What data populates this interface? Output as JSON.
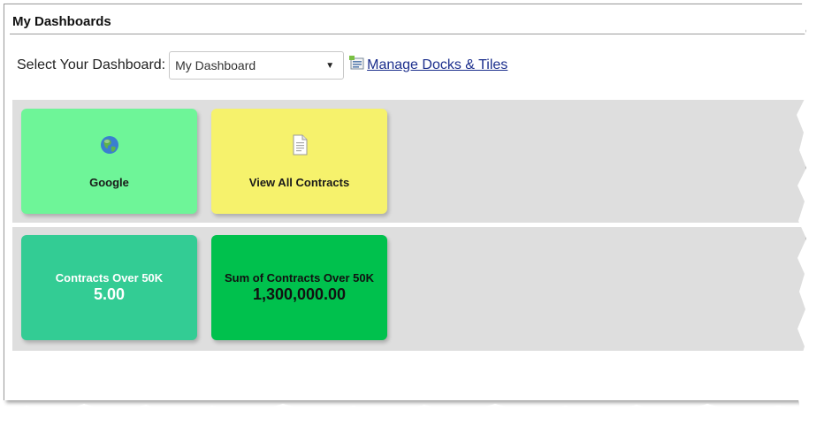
{
  "header": {
    "title": "My Dashboards"
  },
  "selector": {
    "label": "Select Your Dashboard:",
    "selected": "My Dashboard",
    "manage_link": "Manage Docks & Tiles"
  },
  "docks": [
    {
      "tiles": [
        {
          "label": "Google",
          "icon": "globe-icon",
          "color": "#6ef598"
        },
        {
          "label": "View All Contracts",
          "icon": "document-icon",
          "color": "#f6f26c"
        }
      ]
    },
    {
      "tiles": [
        {
          "label": "Contracts Over 50K",
          "value": "5.00",
          "color": "#33cc94"
        },
        {
          "label": "Sum of Contracts Over 50K",
          "value": "1,300,000.00",
          "color": "#00c14d"
        }
      ]
    }
  ]
}
